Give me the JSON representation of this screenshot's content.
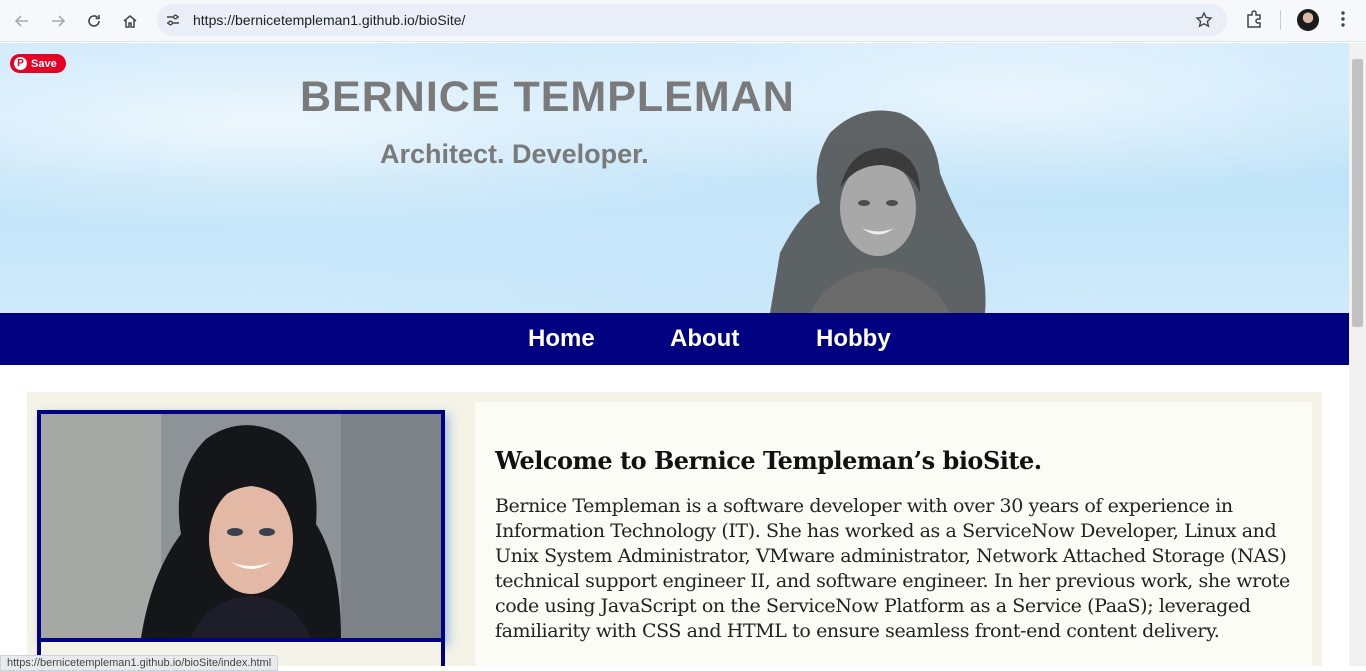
{
  "browser": {
    "url": "https://bernicetempleman1.github.io/bioSite/",
    "status_url": "https://bernicetempleman1.github.io/bioSite/index.html"
  },
  "pinterest": {
    "save_label": "Save"
  },
  "hero": {
    "title": "BERNICE TEMPLEMAN",
    "subtitle": "Architect. Developer."
  },
  "nav": {
    "items": [
      {
        "label": "Home"
      },
      {
        "label": "About"
      },
      {
        "label": "Hobby"
      }
    ],
    "color": "#000080"
  },
  "main": {
    "welcome": "Welcome to Bernice Templeman’s bioSite.",
    "bio": "Bernice Templeman is a software developer with over 30 years of experience in Information Technology (IT). She has worked as a ServiceNow Developer, Linux and Unix System Administrator, VMware administrator, Network Attached Storage (NAS) technical support engineer II, and software engineer. In her previous work, she wrote code using JavaScript on the ServiceNow Platform as a Service (PaaS); leveraged familiarity with CSS and HTML to ensure seamless front-end content delivery."
  }
}
